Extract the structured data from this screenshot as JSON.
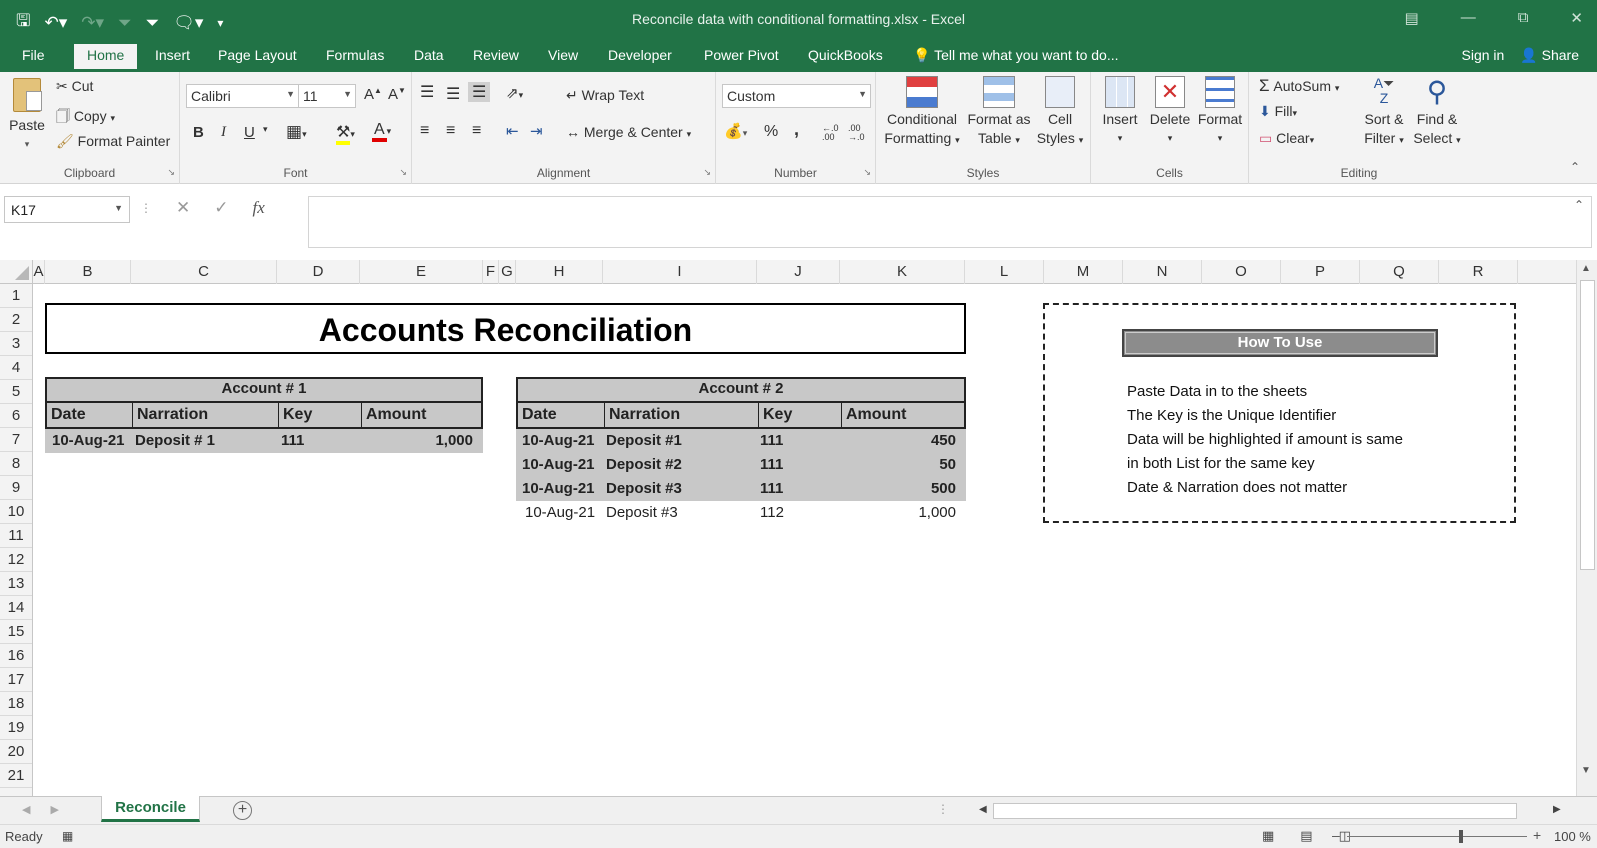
{
  "window": {
    "title": "Reconcile data with conditional formatting.xlsx - Excel"
  },
  "tabs": {
    "file": "File",
    "items": [
      "Home",
      "Insert",
      "Page Layout",
      "Formulas",
      "Data",
      "Review",
      "View",
      "Developer",
      "Power Pivot",
      "QuickBooks"
    ],
    "tell_me": "Tell me what you want to do...",
    "sign_in": "Sign in",
    "share": "Share"
  },
  "ribbon": {
    "clipboard": {
      "paste": "Paste",
      "cut": "Cut",
      "copy": "Copy",
      "format_painter": "Format Painter",
      "label": "Clipboard"
    },
    "font": {
      "name": "Calibri",
      "size": "11",
      "bold": "B",
      "italic": "I",
      "underline": "U",
      "label": "Font"
    },
    "alignment": {
      "wrap_text": "Wrap Text",
      "merge_center": "Merge & Center",
      "label": "Alignment"
    },
    "number": {
      "format": "Custom",
      "percent": "%",
      "comma": ",",
      "label": "Number"
    },
    "styles": {
      "conditional_line1": "Conditional",
      "conditional_line2": "Formatting",
      "format_as_line1": "Format as",
      "format_as_line2": "Table",
      "cell_line1": "Cell",
      "cell_line2": "Styles",
      "label": "Styles"
    },
    "cells": {
      "insert": "Insert",
      "delete": "Delete",
      "format": "Format",
      "label": "Cells"
    },
    "editing": {
      "autosum": "AutoSum",
      "fill": "Fill",
      "clear": "Clear",
      "sort_line1": "Sort &",
      "sort_line2": "Filter",
      "find_line1": "Find &",
      "find_line2": "Select",
      "label": "Editing"
    }
  },
  "formula_bar": {
    "name_box": "K17",
    "fx": "fx",
    "value": ""
  },
  "sheet": {
    "columns": [
      "A",
      "B",
      "C",
      "D",
      "E",
      "F",
      "G",
      "H",
      "I",
      "J",
      "K",
      "L",
      "M",
      "N",
      "O",
      "P",
      "Q",
      "R"
    ],
    "rows": [
      "1",
      "2",
      "3",
      "4",
      "5",
      "6",
      "7",
      "8",
      "9",
      "10",
      "11",
      "12",
      "13",
      "14",
      "15",
      "16",
      "17",
      "18",
      "19",
      "20",
      "21"
    ],
    "title": "Accounts Reconciliation",
    "account1": {
      "heading": "Account # 1",
      "headers": [
        "Date",
        "Narration",
        "Key",
        "Amount"
      ],
      "rows": [
        {
          "date": "10-Aug-21",
          "narration": "Deposit # 1",
          "key": "111",
          "amount": "1,000",
          "highlighted": true
        }
      ]
    },
    "account2": {
      "heading": "Account # 2",
      "headers": [
        "Date",
        "Narration",
        "Key",
        "Amount"
      ],
      "rows": [
        {
          "date": "10-Aug-21",
          "narration": "Deposit #1",
          "key": "111",
          "amount": "450",
          "highlighted": true
        },
        {
          "date": "10-Aug-21",
          "narration": "Deposit #2",
          "key": "111",
          "amount": "50",
          "highlighted": true
        },
        {
          "date": "10-Aug-21",
          "narration": "Deposit #3",
          "key": "111",
          "amount": "500",
          "highlighted": true
        },
        {
          "date": "10-Aug-21",
          "narration": "Deposit #3",
          "key": "112",
          "amount": "1,000",
          "highlighted": false
        }
      ]
    },
    "how_to_use": {
      "button": "How To Use",
      "lines": [
        "Paste Data in to the sheets",
        "The Key is the Unique Identifier",
        "Data will be highlighted if amount is same",
        "in both List for the same key",
        "Date & Narration does not matter"
      ]
    }
  },
  "sheet_tabs": {
    "active": "Reconcile"
  },
  "status": {
    "ready": "Ready",
    "zoom": "100 %"
  },
  "colors": {
    "excel_green": "#217346",
    "highlight_gray": "#c8c8c8",
    "howto_button": "#8c8c8c"
  }
}
